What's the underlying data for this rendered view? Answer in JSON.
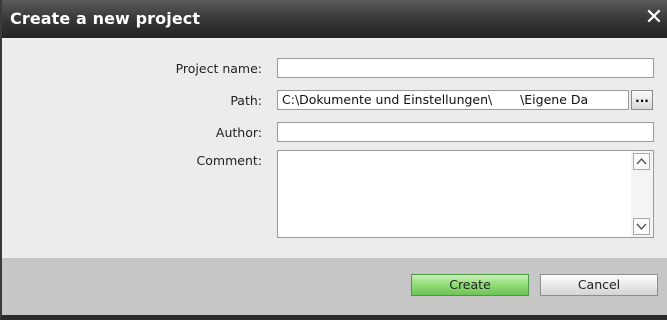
{
  "dialog": {
    "title": "Create a new project",
    "close_glyph": "✕"
  },
  "form": {
    "project_name": {
      "label": "Project name:",
      "value": ""
    },
    "path": {
      "label": "Path:",
      "value": "C:\\Dokumente und Einstellungen\\       \\Eigene Da",
      "browse_label": "..."
    },
    "author": {
      "label": "Author:",
      "value": ""
    },
    "comment": {
      "label": "Comment:",
      "value": ""
    }
  },
  "buttons": {
    "create_label": "Create",
    "cancel_label": "Cancel"
  },
  "icons": {
    "close": "close-icon",
    "scroll_up": "chevron-up-icon",
    "scroll_down": "chevron-down-icon"
  },
  "colors": {
    "titlebar": "#2f2f2f",
    "create_button": "#8fdb76",
    "footer": "#c6c6c6"
  }
}
